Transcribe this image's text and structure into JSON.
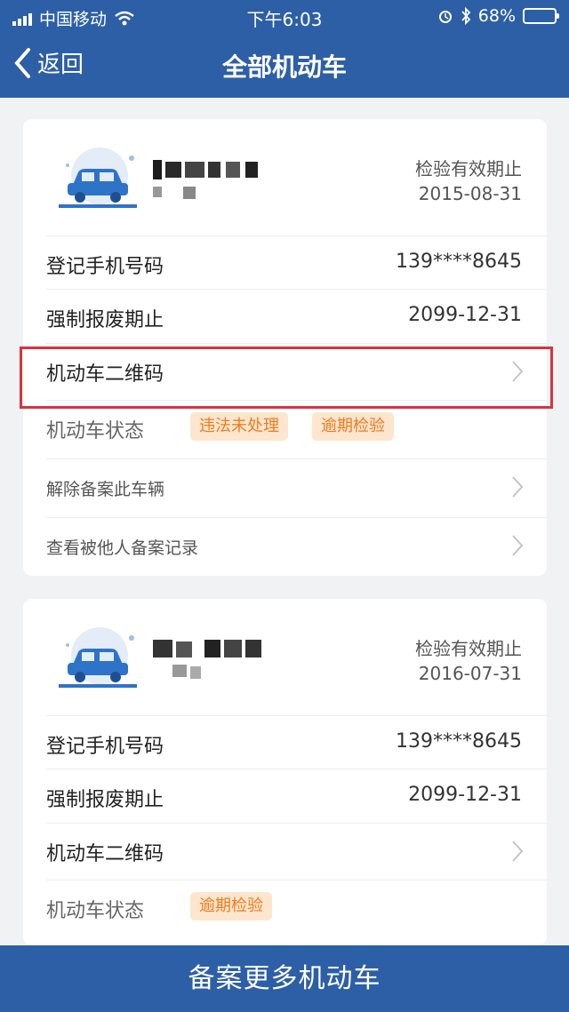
{
  "status_bar": {
    "carrier": "中国移动",
    "time": "下午6:03",
    "battery": "68%",
    "battery_level": 0.68
  },
  "nav": {
    "back_label": "返回",
    "title": "全部机动车"
  },
  "vehicles": [
    {
      "inspect_label": "检验有效期止",
      "inspect_date": "2015-08-31",
      "phone_label": "登记手机号码",
      "phone": "139****8645",
      "scrap_label": "强制报废期止",
      "scrap_date": "2099-12-31",
      "qr_label": "机动车二维码",
      "status_label": "机动车状态",
      "status_tags": [
        "违法未处理",
        "逾期检验"
      ],
      "unregister_label": "解除备案此车辆",
      "records_label": "查看被他人备案记录"
    },
    {
      "inspect_label": "检验有效期止",
      "inspect_date": "2016-07-31",
      "phone_label": "登记手机号码",
      "phone": "139****8645",
      "scrap_label": "强制报废期止",
      "scrap_date": "2099-12-31",
      "qr_label": "机动车二维码",
      "status_label": "机动车状态",
      "status_tags": [
        "逾期检验"
      ]
    }
  ],
  "bottom_button": "备案更多机动车",
  "colors": {
    "brand": "#2d5fa6",
    "tag_bg": "#fde6cd",
    "tag_text": "#ee7b1f",
    "highlight": "#d9333c"
  },
  "icons": [
    "signal-icon",
    "wifi-icon",
    "alarm-icon",
    "bluetooth-icon",
    "battery-icon",
    "back-chevron-icon",
    "car-icon",
    "chevron-right-icon"
  ]
}
